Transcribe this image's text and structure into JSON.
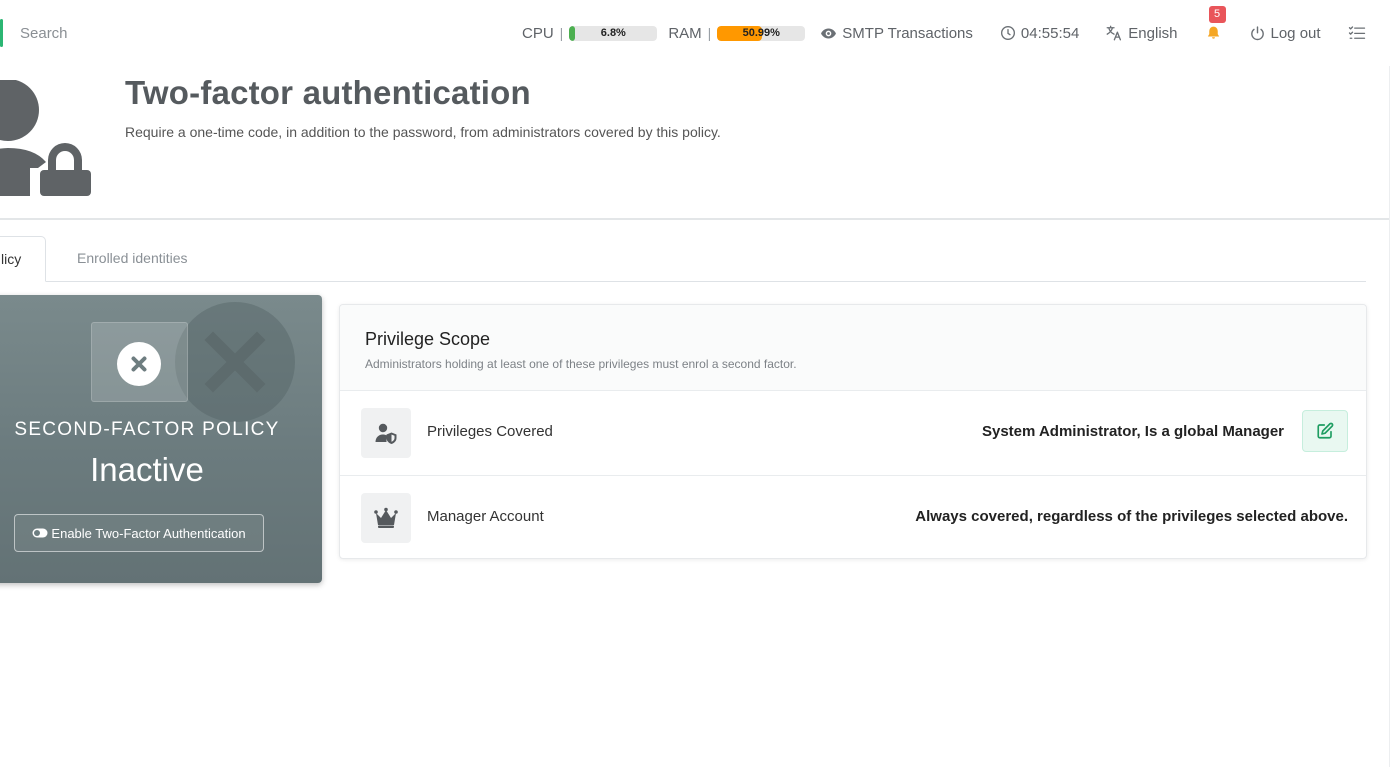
{
  "topbar": {
    "search_placeholder": "Search",
    "cpu": {
      "label": "CPU",
      "separator": "|",
      "value": "6.8%",
      "fraction": 0.068,
      "color": "#4caf50"
    },
    "ram": {
      "label": "RAM",
      "separator": "|",
      "value": "50.99%",
      "fraction": 0.5099,
      "color": "#ff9800"
    },
    "smtp_label": "SMTP Transactions",
    "clock": "04:55:54",
    "language": "English",
    "notifications_count": "5",
    "logout_label": "Log out"
  },
  "header": {
    "title": "Two-factor authentication",
    "subtitle": "Require a one-time code, in addition to the password, from administrators covered by this policy."
  },
  "tabs": [
    {
      "label": "Policy",
      "visible_label": "licy",
      "active": true
    },
    {
      "label": "Enrolled identities",
      "active": false
    }
  ],
  "status_card": {
    "eyebrow": "SECOND-FACTOR POLICY",
    "status": "Inactive",
    "button_label": "Enable Two-Factor Authentication"
  },
  "privilege_scope": {
    "title": "Privilege Scope",
    "subtitle": "Administrators holding at least one of these privileges must enrol a second factor.",
    "rows": [
      {
        "icon": "user-shield-icon",
        "label": "Privileges Covered",
        "value": "System Administrator, Is a global Manager"
      },
      {
        "icon": "crown-icon",
        "label": "Manager Account",
        "value": "Always covered, regardless of the privileges selected above."
      }
    ]
  },
  "colors": {
    "accent": "#2bb673",
    "status_card_bg": "#6e7e81",
    "badge": "#e9555a"
  }
}
